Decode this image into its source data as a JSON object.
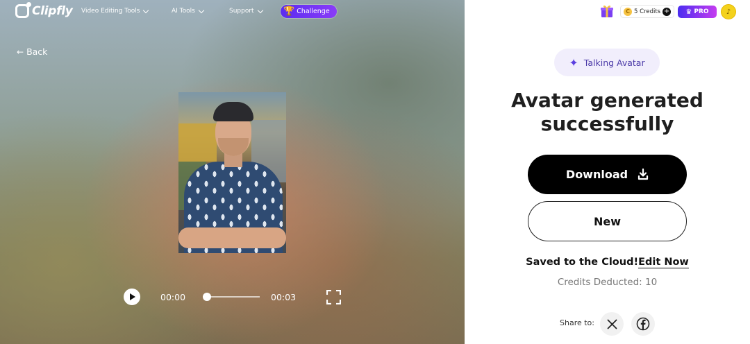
{
  "brand": {
    "name": "Clipfly"
  },
  "nav": {
    "items": [
      {
        "label": "Video Editing Tools"
      },
      {
        "label": "AI Tools"
      },
      {
        "label": "Support"
      }
    ],
    "challenge_label": "Challenge"
  },
  "back_label": "Back",
  "player": {
    "current_time": "00:00",
    "duration": "00:03",
    "progress": 0
  },
  "account": {
    "credits_label": "5 Credits",
    "coin_symbol": "C",
    "plus_symbol": "+",
    "pro_label": "PRO"
  },
  "result": {
    "badge_label": "Talking Avatar",
    "headline_line1": "Avatar generated",
    "headline_line2": "successfully",
    "download_label": "Download",
    "new_label": "New",
    "saved_text": "Saved to the Cloud!",
    "edit_link": "Edit Now",
    "credits_deducted": "Credits Deducted: 10",
    "share_label": "Share to:"
  },
  "icons": {
    "gift": "gift-icon",
    "x": "x-twitter-icon",
    "facebook": "facebook-icon",
    "download": "download-icon",
    "fullscreen": "fullscreen-icon"
  },
  "colors": {
    "accent_purple": "#5b2cf0",
    "badge_bg": "#f1eefc",
    "primary_black": "#000000"
  }
}
